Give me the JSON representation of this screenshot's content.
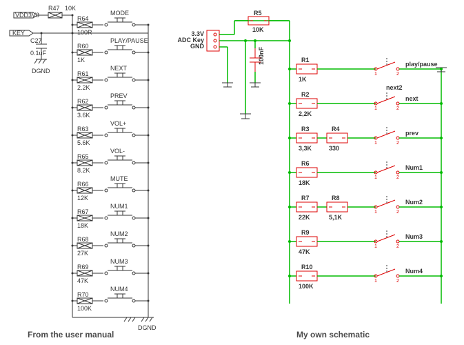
{
  "captions": {
    "left": "From the user manual",
    "right": "My own schematic"
  },
  "left": {
    "power": "VDD3V3",
    "key": "KEY",
    "dgnd": "DGND",
    "pullup": {
      "ref": "R47",
      "val": "10K"
    },
    "cap": {
      "ref": "C27",
      "val": "0.1uF"
    },
    "rows": [
      {
        "ref": "R64",
        "val": "100R",
        "sw": "MODE"
      },
      {
        "ref": "R60",
        "val": "1K",
        "sw": "PLAY/PAUSE"
      },
      {
        "ref": "R61",
        "val": "2.2K",
        "sw": "NEXT"
      },
      {
        "ref": "R62",
        "val": "3.6K",
        "sw": "PREV"
      },
      {
        "ref": "R63",
        "val": "5.6K",
        "sw": "VOL+"
      },
      {
        "ref": "R65",
        "val": "8.2K",
        "sw": "VOL-"
      },
      {
        "ref": "R66",
        "val": "12K",
        "sw": "MUTE"
      },
      {
        "ref": "R67",
        "val": "18K",
        "sw": "NUM1"
      },
      {
        "ref": "R68",
        "val": "27K",
        "sw": "NUM2"
      },
      {
        "ref": "R69",
        "val": "47K",
        "sw": "NUM3"
      },
      {
        "ref": "R70",
        "val": "100K",
        "sw": "NUM4"
      }
    ]
  },
  "right": {
    "conn": {
      "l1": "3.3V",
      "l2": "ADC Key",
      "l3": "GND"
    },
    "capval": "100nF",
    "r5": {
      "ref": "R5",
      "val": "10K"
    },
    "rows": [
      {
        "res": [
          {
            "ref": "R1",
            "val": "1K"
          }
        ],
        "sw": "play/pause",
        "short": ""
      },
      {
        "res": [
          {
            "ref": "R2",
            "val": "2,2K"
          }
        ],
        "sw": "next",
        "short": "next2"
      },
      {
        "res": [
          {
            "ref": "R3",
            "val": "3,3K"
          },
          {
            "ref": "R4",
            "val": "330"
          }
        ],
        "sw": "prev",
        "short": ""
      },
      {
        "res": [
          {
            "ref": "R6",
            "val": "18K"
          }
        ],
        "sw": "Num1",
        "short": ""
      },
      {
        "res": [
          {
            "ref": "R7",
            "val": "22K"
          },
          {
            "ref": "R8",
            "val": "5,1K"
          }
        ],
        "sw": "Num2",
        "short": ""
      },
      {
        "res": [
          {
            "ref": "R9",
            "val": "47K"
          }
        ],
        "sw": "Num3",
        "short": ""
      },
      {
        "res": [
          {
            "ref": "R10",
            "val": "100K"
          }
        ],
        "sw": "Num4",
        "short": ""
      }
    ]
  }
}
